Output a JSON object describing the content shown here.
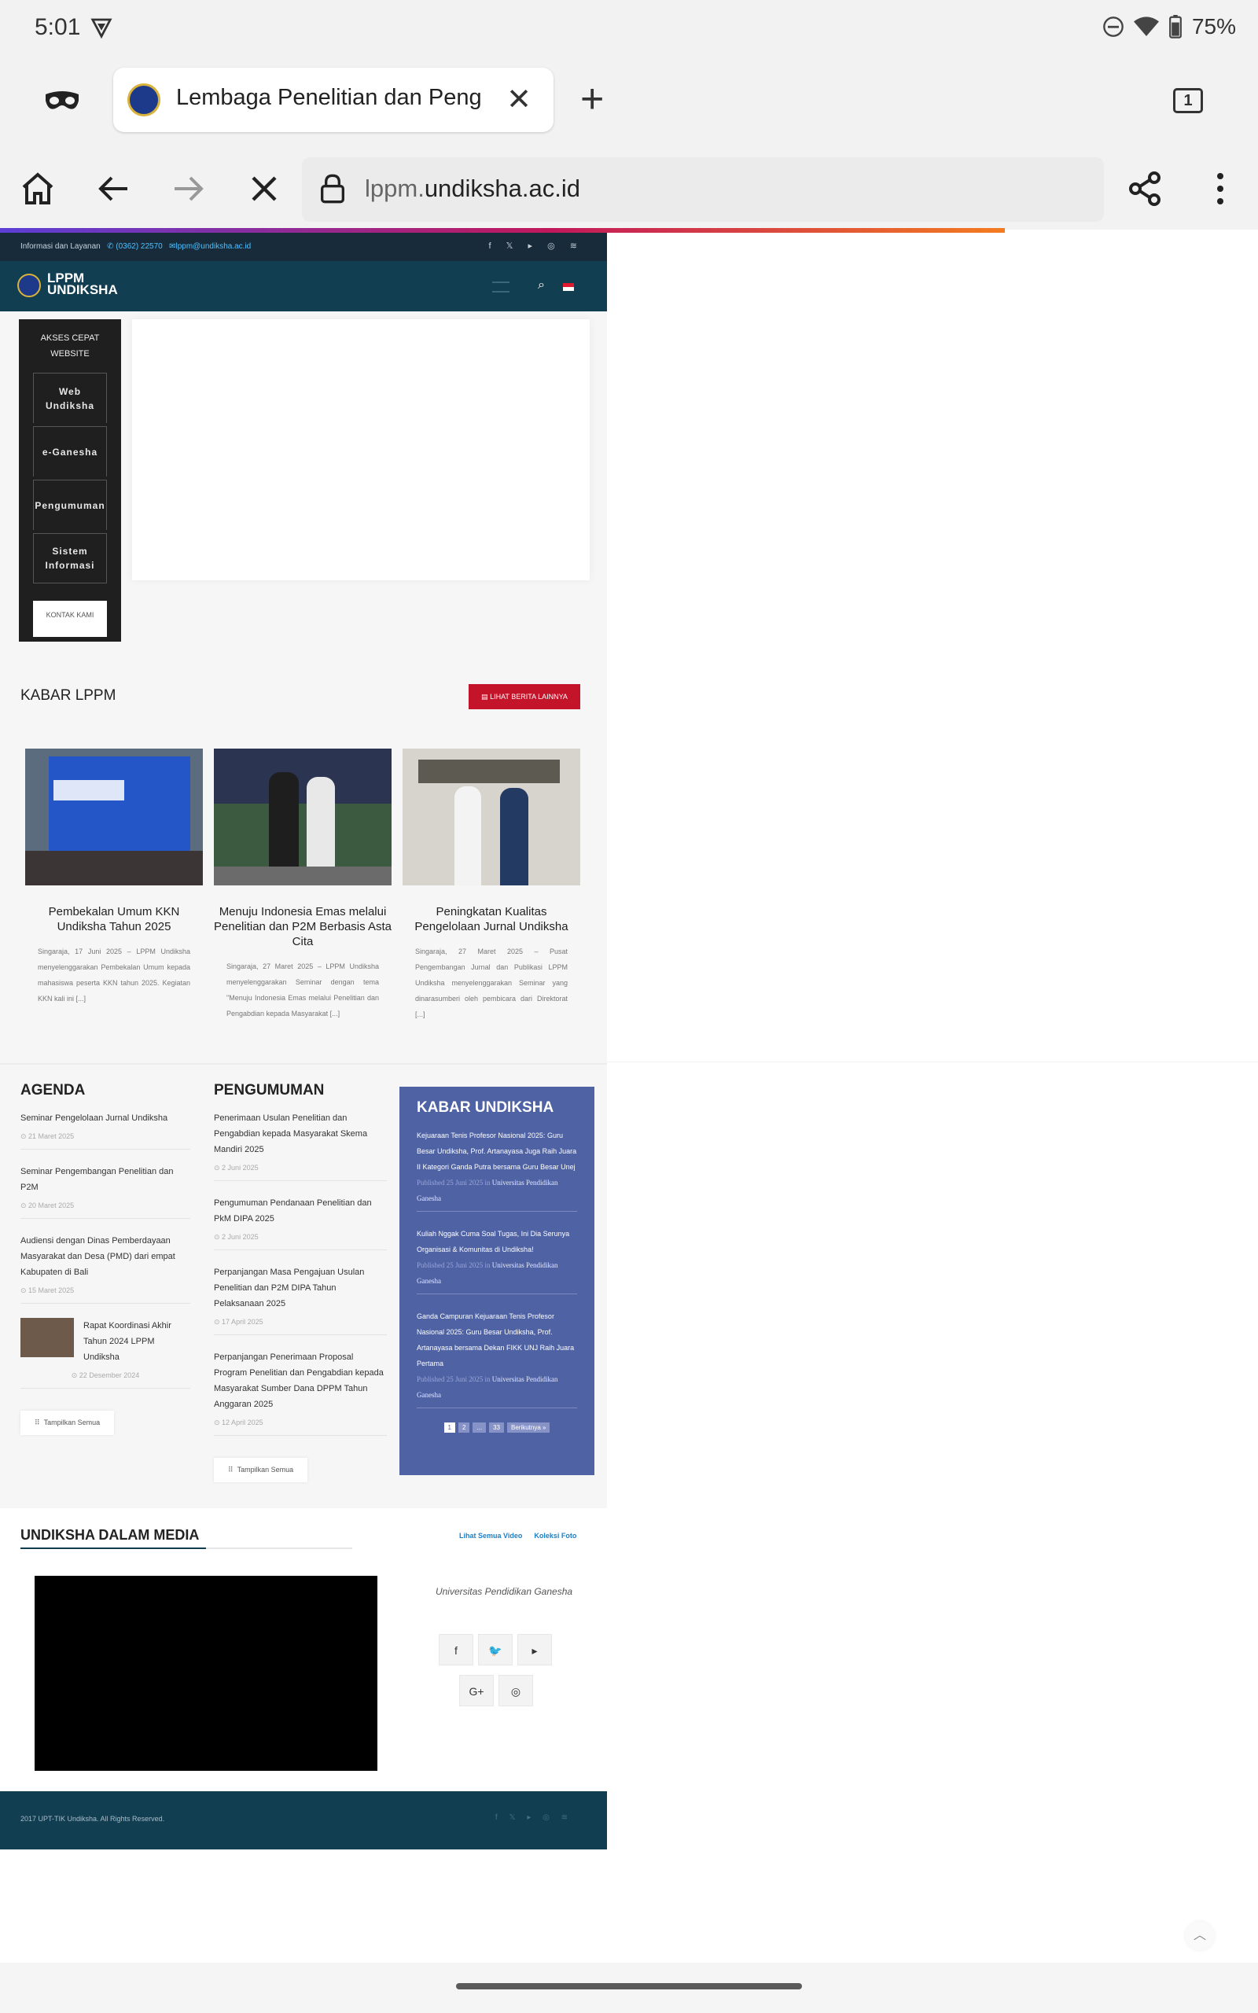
{
  "status_bar": {
    "time": "5:01",
    "battery": "75%"
  },
  "browser": {
    "tab_title": "Lembaga Penelitian dan Peng",
    "tab_count": "1",
    "url_prefix": "lppm.",
    "url_domain": "undiksha.ac.id"
  },
  "site": {
    "topbar_text": "Informasi dan Layanan",
    "topbar_phone": "(0362) 22570",
    "topbar_email": "lppm@undiksha.ac.id",
    "brand_line1": "LPPM",
    "brand_line2": "UNDIKSHA",
    "quick_access": {
      "title_line1": "AKSES CEPAT",
      "title_line2": "WEBSITE",
      "items": [
        "Web Undiksha",
        "e-Ganesha",
        "Pengumuman",
        "Sistem Informasi"
      ],
      "contact": "KONTAK KAMI"
    },
    "kabar_lppm": {
      "title": "KABAR LPPM",
      "more_button": "LIHAT BERITA LAINNYA",
      "cards": [
        {
          "title": "Pembekalan Umum KKN Undiksha Tahun 2025",
          "excerpt": "Singaraja, 17 Juni 2025 – LPPM Undiksha menyelenggarakan Pembekalan Umum kepada mahasiswa peserta KKN tahun 2025. Kegiatan KKN kali ini [...]"
        },
        {
          "title": "Menuju Indonesia Emas melalui Penelitian dan P2M Berbasis Asta Cita",
          "excerpt": "Singaraja, 27 Maret 2025 – LPPM Undiksha menyelenggarakan Seminar dengan tema \"Menuju Indonesia Emas melalui Penelitian dan Pengabdian kepada Masyarakat [...]"
        },
        {
          "title": "Peningkatan Kualitas Pengelolaan Jurnal Undiksha",
          "excerpt": "Singaraja, 27 Maret 2025 – Pusat Pengembangan Jurnal dan Publikasi LPPM Undiksha menyelenggarakan Seminar yang dinarasumberi oleh pembicara dari Direktorat [...]"
        }
      ]
    },
    "agenda": {
      "title": "AGENDA",
      "items": [
        {
          "text": "Seminar Pengelolaan Jurnal Undiksha",
          "date": "21 Maret 2025"
        },
        {
          "text": "Seminar Pengembangan Penelitian dan P2M",
          "date": "20 Maret 2025"
        },
        {
          "text": "Audiensi dengan Dinas Pemberdayaan Masyarakat dan Desa (PMD) dari empat Kabupaten di Bali",
          "date": "15 Maret 2025"
        },
        {
          "text": "Rapat Koordinasi Akhir Tahun 2024 LPPM Undiksha",
          "date": "22 Desember 2024"
        }
      ],
      "show_all": "Tampilkan Semua"
    },
    "pengumuman": {
      "title": "PENGUMUMAN",
      "items": [
        {
          "text": "Penerimaan Usulan Penelitian dan Pengabdian kepada Masyarakat Skema Mandiri 2025",
          "date": "2 Juni 2025"
        },
        {
          "text": "Pengumuman Pendanaan Penelitian dan PkM DIPA 2025",
          "date": "2 Juni 2025"
        },
        {
          "text": "Perpanjangan Masa Pengajuan Usulan Penelitian dan P2M DIPA Tahun Pelaksanaan 2025",
          "date": "17 April 2025"
        },
        {
          "text": "Perpanjangan Penerimaan Proposal Program Penelitian dan Pengabdian kepada Masyarakat Sumber Dana DPPM Tahun Anggaran 2025",
          "date": "12 April 2025"
        }
      ],
      "show_all": "Tampilkan Semua"
    },
    "kabar_undiksha": {
      "title": "KABAR UNDIKSHA",
      "items": [
        {
          "text": "Kejuaraan Tenis Profesor Nasional 2025: Guru Besar Undiksha, Prof. Artanayasa Juga Raih Juara II Kategori Ganda Putra bersama Guru Besar Unej",
          "published": "Published 25 Juni 2025 in",
          "source": "Universitas Pendidikan Ganesha"
        },
        {
          "text": "Kuliah Nggak Cuma Soal Tugas, Ini Dia Serunya Organisasi & Komunitas di Undiksha!",
          "published": "Published 25 Juni 2025 in",
          "source": "Universitas Pendidikan Ganesha"
        },
        {
          "text": "Ganda Campuran Kejuaraan Tenis Profesor Nasional 2025: Guru Besar Undiksha, Prof. Artanayasa bersama Dekan FIKK UNJ Raih Juara Pertama",
          "published": "Published 25 Juni 2025 in",
          "source": "Universitas Pendidikan Ganesha"
        }
      ],
      "pager": [
        "1",
        "2",
        "...",
        "33",
        "Berikutnya »"
      ]
    },
    "media": {
      "title": "UNDIKSHA DALAM MEDIA",
      "link_videos": "Lihat Semua Video",
      "link_photos": "Koleksi Foto",
      "university": "Universitas Pendidikan Ganesha"
    },
    "footer": {
      "copyright": "2017 UPT-TIK Undiksha. All Rights Reserved."
    }
  },
  "colors": {
    "navbar": "#123e52",
    "topbar": "#172b3a",
    "accent_red": "#c4142a",
    "kabar_undiksha_bg": "#4f62a4"
  }
}
